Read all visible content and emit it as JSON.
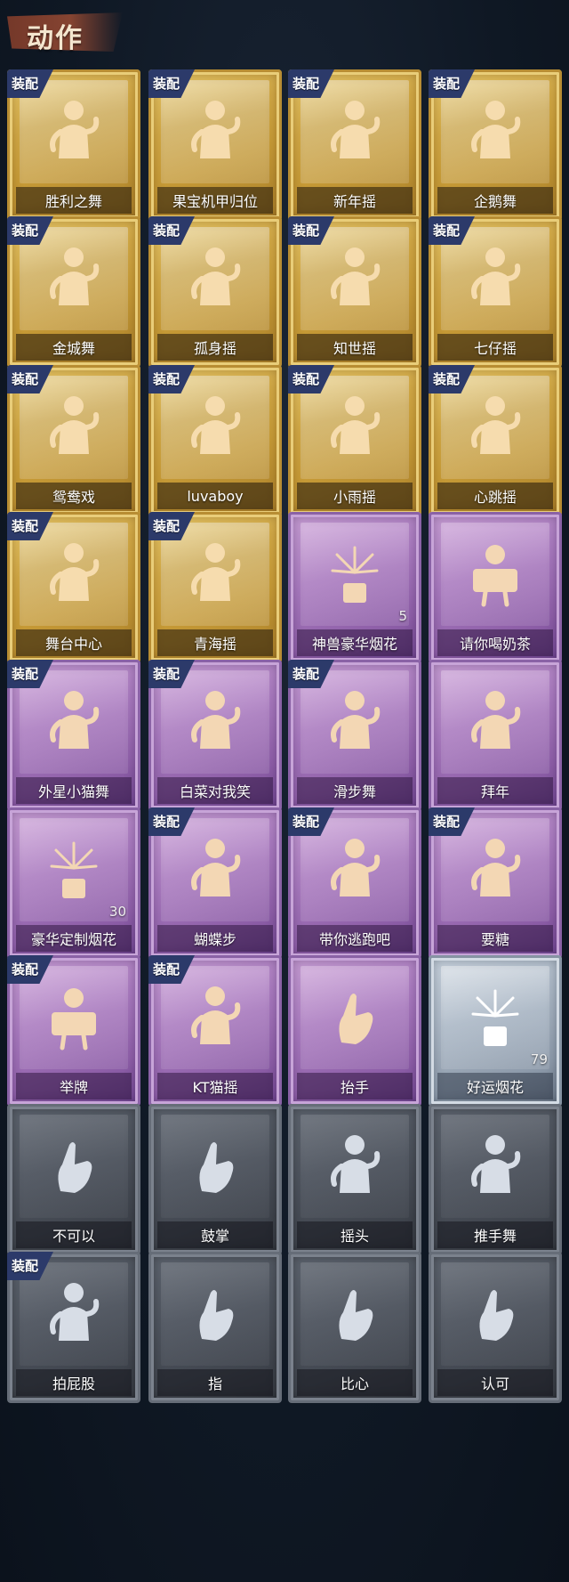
{
  "header": {
    "title": "动作"
  },
  "equip_label": "装配",
  "cards": [
    {
      "label": "胜利之舞",
      "tier": "gold",
      "equipped": true,
      "icon": "dance-figure-icon"
    },
    {
      "label": "果宝机甲归位",
      "tier": "gold",
      "equipped": true,
      "icon": "dance-figure-icon"
    },
    {
      "label": "新年摇",
      "tier": "gold",
      "equipped": true,
      "icon": "dance-figure-icon"
    },
    {
      "label": "企鹅舞",
      "tier": "gold",
      "equipped": true,
      "icon": "dance-figure-icon"
    },
    {
      "label": "金城舞",
      "tier": "gold",
      "equipped": true,
      "icon": "dance-figure-icon"
    },
    {
      "label": "孤身摇",
      "tier": "gold",
      "equipped": true,
      "icon": "dance-figure-icon"
    },
    {
      "label": "知世摇",
      "tier": "gold",
      "equipped": true,
      "icon": "dance-figure-icon"
    },
    {
      "label": "七仔摇",
      "tier": "gold",
      "equipped": true,
      "icon": "dance-figure-icon"
    },
    {
      "label": "鸳鸯戏",
      "tier": "gold",
      "equipped": true,
      "icon": "dance-figure-icon"
    },
    {
      "label": "luvaboy",
      "tier": "gold",
      "equipped": true,
      "icon": "dance-figure-icon"
    },
    {
      "label": "小雨摇",
      "tier": "gold",
      "equipped": true,
      "icon": "dance-figure-icon"
    },
    {
      "label": "心跳摇",
      "tier": "gold",
      "equipped": true,
      "icon": "dance-figure-icon"
    },
    {
      "label": "舞台中心",
      "tier": "gold",
      "equipped": true,
      "icon": "dance-figure-icon"
    },
    {
      "label": "青海摇",
      "tier": "gold",
      "equipped": true,
      "icon": "dance-figure-icon"
    },
    {
      "label": "神兽豪华烟花",
      "tier": "purple",
      "equipped": false,
      "icon": "firework-pot-icon",
      "count": "5"
    },
    {
      "label": "请你喝奶茶",
      "tier": "purple",
      "equipped": false,
      "icon": "sign-holder-icon"
    },
    {
      "label": "外星小猫舞",
      "tier": "purple",
      "equipped": true,
      "icon": "dance-figure-icon"
    },
    {
      "label": "白菜对我笑",
      "tier": "purple",
      "equipped": true,
      "icon": "dance-figure-icon"
    },
    {
      "label": "滑步舞",
      "tier": "purple",
      "equipped": true,
      "icon": "dance-figure-icon"
    },
    {
      "label": "拜年",
      "tier": "purple",
      "equipped": false,
      "icon": "bow-figure-icon"
    },
    {
      "label": "豪华定制烟花",
      "tier": "purple",
      "equipped": false,
      "icon": "firework-box-icon",
      "count": "30"
    },
    {
      "label": "蝴蝶步",
      "tier": "purple",
      "equipped": true,
      "icon": "dance-figure-icon"
    },
    {
      "label": "带你逃跑吧",
      "tier": "purple",
      "equipped": true,
      "icon": "dance-figure-icon"
    },
    {
      "label": "要糖",
      "tier": "purple",
      "equipped": true,
      "icon": "dance-figure-icon"
    },
    {
      "label": "举牌",
      "tier": "purple",
      "equipped": true,
      "icon": "sign-holder-icon"
    },
    {
      "label": "KT猫摇",
      "tier": "purple",
      "equipped": true,
      "icon": "dance-figure-icon"
    },
    {
      "label": "抬手",
      "tier": "purple",
      "equipped": false,
      "icon": "raise-hand-icon"
    },
    {
      "label": "好运烟花",
      "tier": "silver",
      "equipped": false,
      "icon": "firework-can-icon",
      "count": "79"
    },
    {
      "label": "不可以",
      "tier": "gray",
      "equipped": false,
      "icon": "finger-wag-icon"
    },
    {
      "label": "鼓掌",
      "tier": "gray",
      "equipped": false,
      "icon": "clap-hands-icon"
    },
    {
      "label": "摇头",
      "tier": "gray",
      "equipped": false,
      "icon": "shake-head-icon"
    },
    {
      "label": "推手舞",
      "tier": "gray",
      "equipped": false,
      "icon": "push-hand-icon"
    },
    {
      "label": "拍屁股",
      "tier": "gray",
      "equipped": true,
      "icon": "slap-figure-icon"
    },
    {
      "label": "指",
      "tier": "gray",
      "equipped": false,
      "icon": "point-hand-icon"
    },
    {
      "label": "比心",
      "tier": "gray",
      "equipped": false,
      "icon": "heart-hand-icon"
    },
    {
      "label": "认可",
      "tier": "gray",
      "equipped": false,
      "icon": "thumbs-up-icon"
    }
  ]
}
